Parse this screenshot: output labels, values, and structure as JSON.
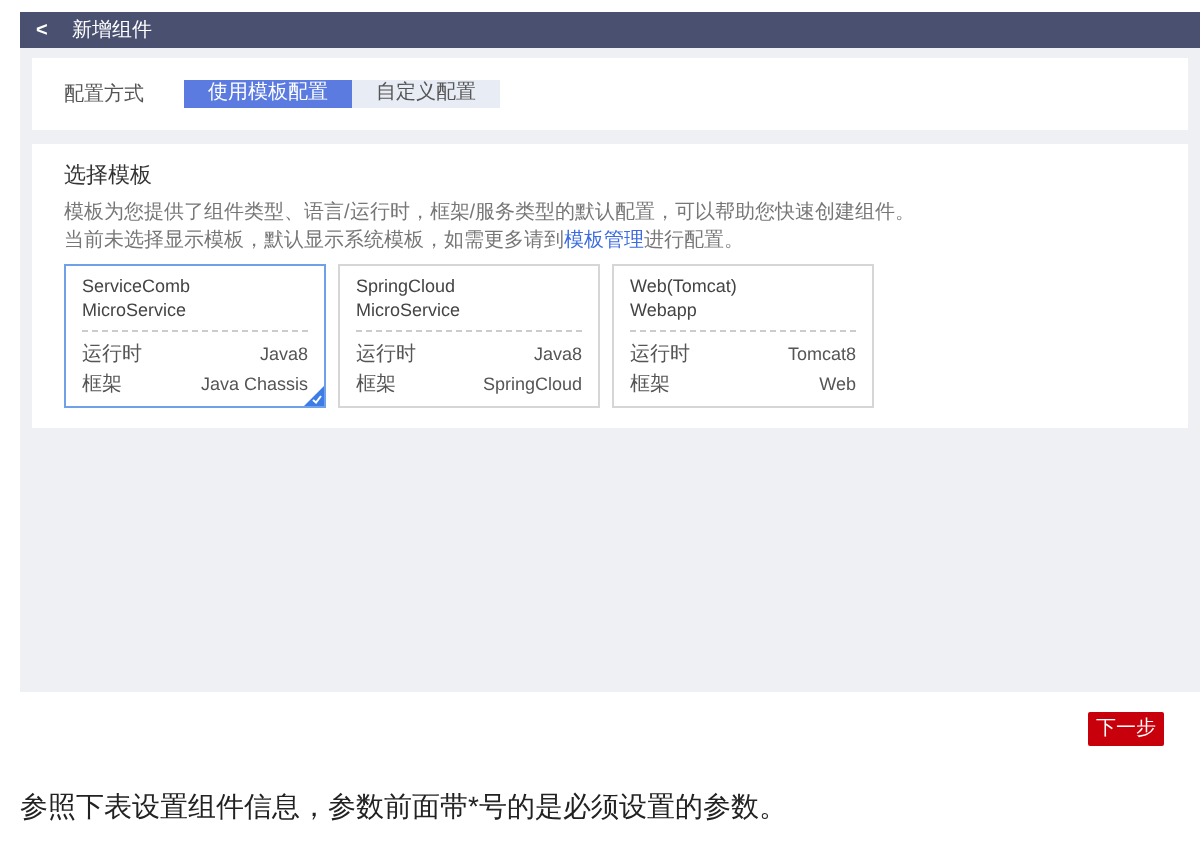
{
  "header": {
    "back": "<",
    "title": "新增组件"
  },
  "config": {
    "label": "配置方式",
    "options": [
      {
        "label": "使用模板配置",
        "selected": true
      },
      {
        "label": "自定义配置",
        "selected": false
      }
    ]
  },
  "templates": {
    "title": "选择模板",
    "description": "模板为您提供了组件类型、语言/运行时，框架/服务类型的默认配置，可以帮助您快速创建组件。",
    "note_prefix": "当前未选择显示模板，默认显示系统模板，如需更多请到",
    "note_link": "模板管理",
    "note_suffix": "进行配置。",
    "cards": [
      {
        "name": "ServiceComb\nMicroService",
        "runtime_label": "运行时",
        "runtime": "Java8",
        "framework_label": "框架",
        "framework": "Java Chassis",
        "selected": true
      },
      {
        "name": "SpringCloud\nMicroService",
        "runtime_label": "运行时",
        "runtime": "Java8",
        "framework_label": "框架",
        "framework": "SpringCloud",
        "selected": false
      },
      {
        "name": "Web(Tomcat)\nWebapp",
        "runtime_label": "运行时",
        "runtime": "Tomcat8",
        "framework_label": "框架",
        "framework": "Web",
        "selected": false
      }
    ]
  },
  "next_button": "下一步",
  "caption": "参照下表设置组件信息，参数前面带*号的是必须设置的参数。"
}
